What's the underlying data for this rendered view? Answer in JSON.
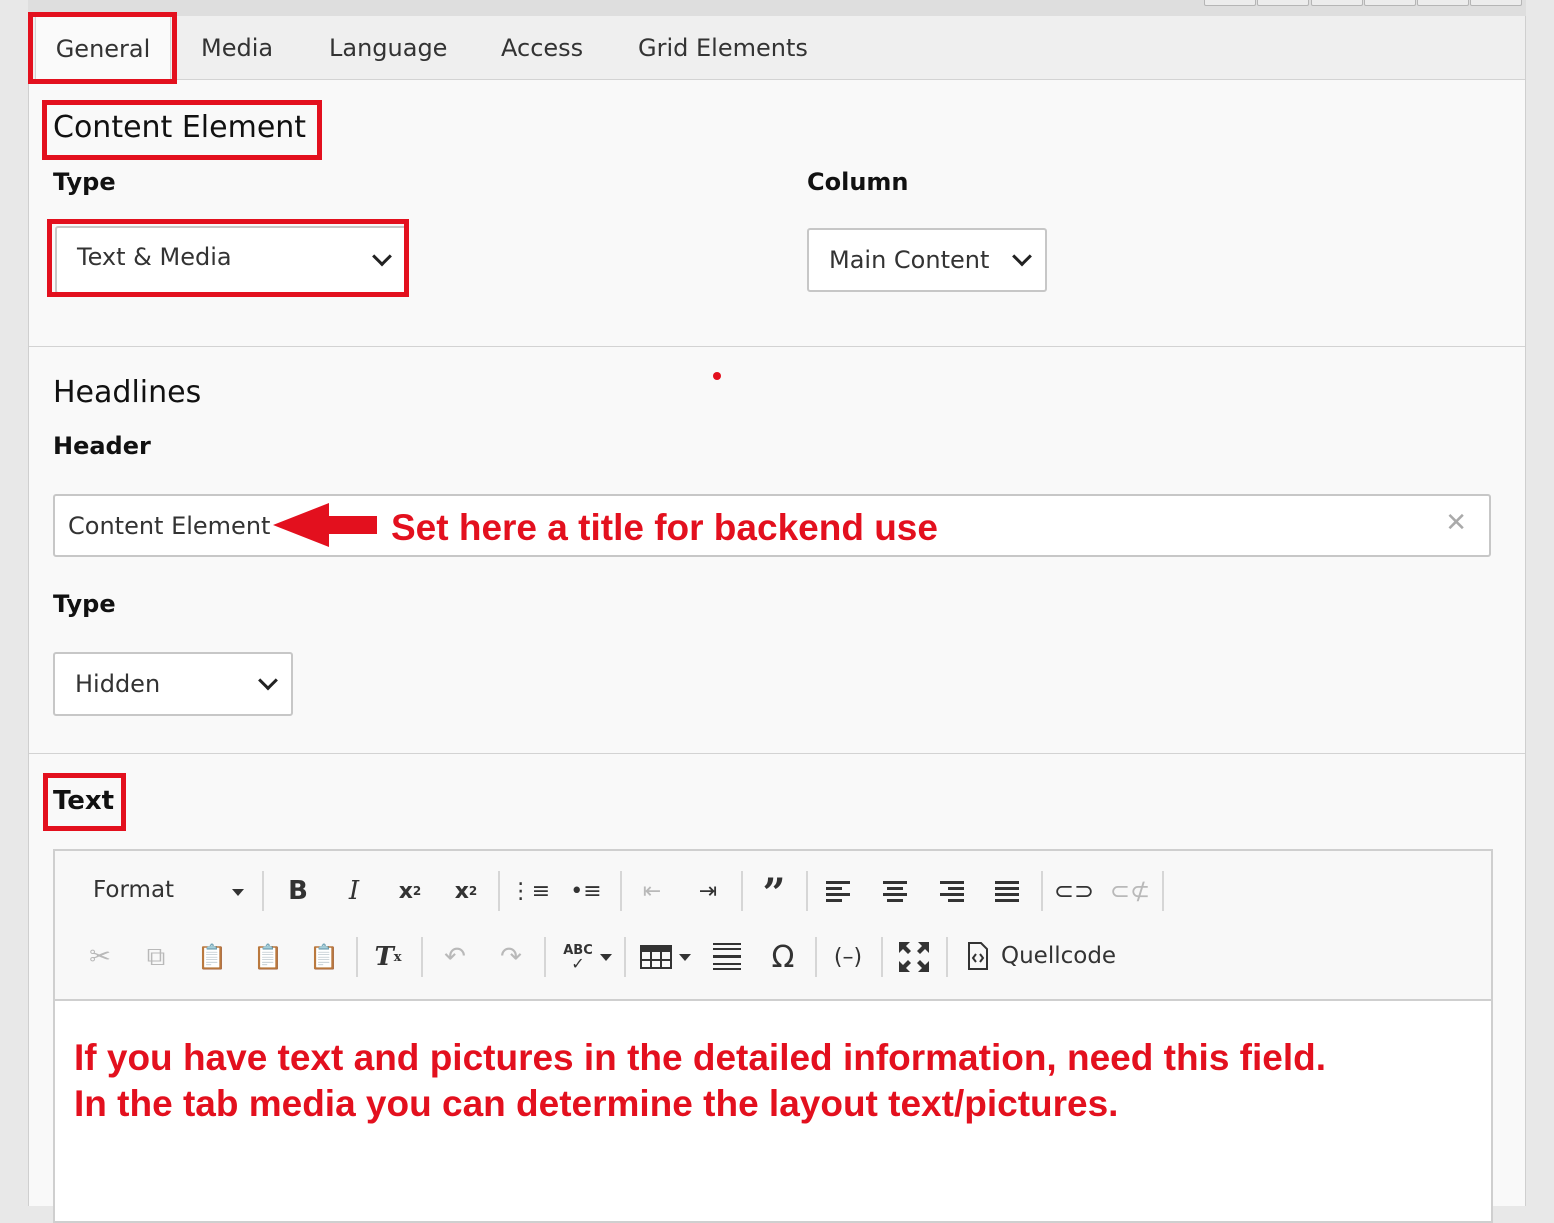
{
  "tabs": [
    {
      "label": "General",
      "active": true
    },
    {
      "label": "Media",
      "active": false
    },
    {
      "label": "Language",
      "active": false
    },
    {
      "label": "Access",
      "active": false
    },
    {
      "label": "Grid Elements",
      "active": false
    }
  ],
  "content_element": {
    "title": "Content Element",
    "type_label": "Type",
    "type_value": "Text & Media",
    "column_label": "Column",
    "column_value": "Main Content"
  },
  "headlines": {
    "title": "Headlines",
    "header_label": "Header",
    "header_value": "Content Element",
    "type_label": "Type",
    "type_value": "Hidden"
  },
  "text_section": {
    "label": "Text",
    "format_label": "Format",
    "source_label": "Quellcode"
  },
  "annotations": {
    "header_hint": "Set here a title for backend use",
    "text_hint_line1": "If you have text and pictures in the detailed information, need this field.",
    "text_hint_line2": "In the tab media you can determine the layout text/pictures."
  },
  "colors": {
    "annotation_red": "#e3101e",
    "panel_bg": "#f9f9f9",
    "tabbar_bg": "#efefef"
  },
  "icons": [
    "bold-icon",
    "italic-icon",
    "subscript-icon",
    "superscript-icon",
    "numbered-list-icon",
    "bulleted-list-icon",
    "outdent-icon",
    "indent-icon",
    "blockquote-icon",
    "align-left-icon",
    "align-center-icon",
    "align-right-icon",
    "justify-icon",
    "link-icon",
    "unlink-icon",
    "cut-icon",
    "copy-icon",
    "paste-icon",
    "paste-text-icon",
    "paste-word-icon",
    "remove-format-icon",
    "undo-icon",
    "redo-icon",
    "spellcheck-icon",
    "table-icon",
    "horizontal-rule-icon",
    "special-char-icon",
    "soft-hyphen-icon",
    "maximize-icon",
    "source-code-icon",
    "clear-icon"
  ]
}
